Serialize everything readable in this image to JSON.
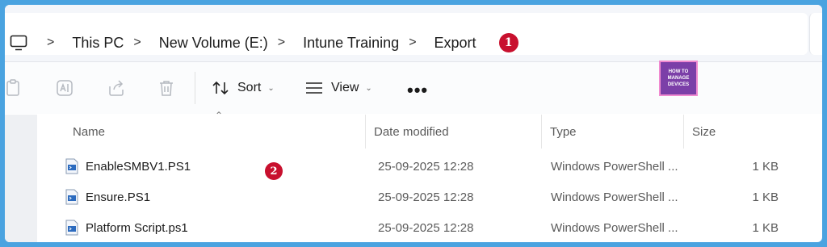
{
  "breadcrumb": {
    "items": [
      "This PC",
      "New Volume (E:)",
      "Intune Training",
      "Export"
    ],
    "separator": ">"
  },
  "annotations": {
    "badge1": "1",
    "badge2": "2",
    "color": "#c8102e"
  },
  "toolbar": {
    "sort_label": "Sort",
    "view_label": "View",
    "more_label": "•••"
  },
  "logo": {
    "line1": "HOW TO",
    "line2": "MANAGE",
    "line3": "DEVICES"
  },
  "table": {
    "headers": {
      "name": "Name",
      "date": "Date modified",
      "type": "Type",
      "size": "Size"
    },
    "rows": [
      {
        "name": "EnableSMBV1.PS1",
        "date": "25-09-2025 12:28",
        "type": "Windows PowerShell ...",
        "size": "1 KB"
      },
      {
        "name": "Ensure.PS1",
        "date": "25-09-2025 12:28",
        "type": "Windows PowerShell ...",
        "size": "1 KB"
      },
      {
        "name": "Platform Script.ps1",
        "date": "25-09-2025 12:28",
        "type": "Windows PowerShell ...",
        "size": "1 KB"
      }
    ]
  }
}
